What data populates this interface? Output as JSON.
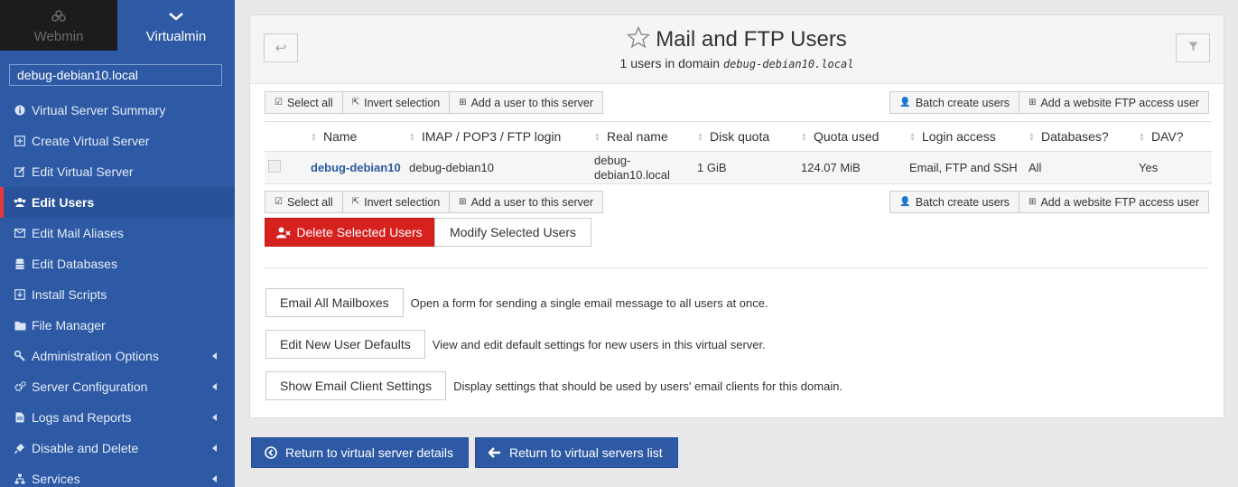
{
  "sidebar": {
    "webmin_tab": "Webmin",
    "virtualmin_tab": "Virtualmin",
    "domain": "debug-debian10.local",
    "items": [
      {
        "label": "Virtual Server Summary"
      },
      {
        "label": "Create Virtual Server"
      },
      {
        "label": "Edit Virtual Server"
      },
      {
        "label": "Edit Users"
      },
      {
        "label": "Edit Mail Aliases"
      },
      {
        "label": "Edit Databases"
      },
      {
        "label": "Install Scripts"
      },
      {
        "label": "File Manager"
      },
      {
        "label": "Administration Options"
      },
      {
        "label": "Server Configuration"
      },
      {
        "label": "Logs and Reports"
      },
      {
        "label": "Disable and Delete"
      },
      {
        "label": "Services"
      }
    ]
  },
  "header": {
    "title": "Mail and FTP Users",
    "subtitle_prefix": "1 users in domain",
    "subtitle_domain": "debug-debian10.local"
  },
  "toolbar": {
    "select_all": "Select all",
    "invert_selection": "Invert selection",
    "add_user": "Add a user to this server",
    "batch_create": "Batch create users",
    "add_ftp_user": "Add a website FTP access user"
  },
  "table": {
    "columns": [
      "Name",
      "IMAP / POP3 / FTP login",
      "Real name",
      "Disk quota",
      "Quota used",
      "Login access",
      "Databases?",
      "DAV?"
    ],
    "rows": [
      {
        "name": "debug-debian10",
        "login": "debug-debian10",
        "real_name_1": "debug-",
        "real_name_2": "debian10.local",
        "disk_quota": "1 GiB",
        "quota_used": "124.07 MiB",
        "login_access": "Email, FTP and SSH",
        "databases": "All",
        "dav": "Yes"
      }
    ]
  },
  "actions": {
    "delete_selected": "Delete Selected Users",
    "modify_selected": "Modify Selected Users",
    "email_all": "Email All Mailboxes",
    "email_all_desc": "Open a form for sending a single email message to all users at once.",
    "new_user_defaults": "Edit New User Defaults",
    "new_user_defaults_desc": "View and edit default settings for new users in this virtual server.",
    "email_client": "Show Email Client Settings",
    "email_client_desc": "Display settings that should be used by users' email clients for this domain."
  },
  "footer": {
    "return_details": "Return to virtual server details",
    "return_list": "Return to virtual servers list"
  },
  "colors": {
    "sidebar": "#2e5aa5",
    "danger": "#d6211f",
    "active_marker": "#e23a3a",
    "link": "#2c5aa0"
  }
}
